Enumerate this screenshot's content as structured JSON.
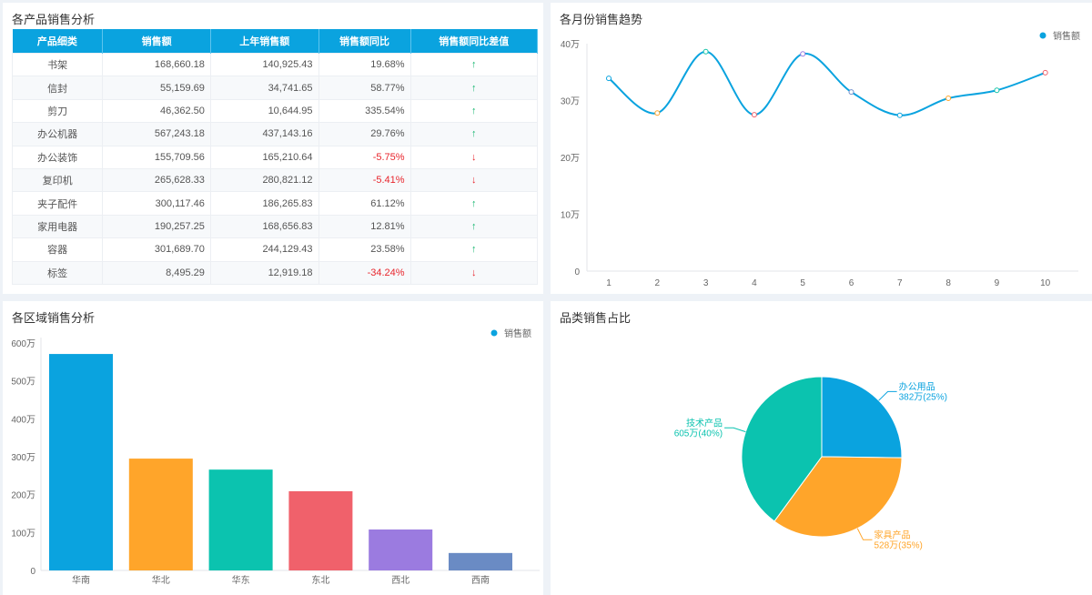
{
  "table_panel": {
    "title": "各产品销售分析",
    "headers": [
      "产品细类",
      "销售额",
      "上年销售额",
      "销售额同比",
      "销售额同比差值"
    ],
    "rows": [
      [
        "书架",
        "168,660.18",
        "140,925.43",
        "19.68%",
        "up"
      ],
      [
        "信封",
        "55,159.69",
        "34,741.65",
        "58.77%",
        "up"
      ],
      [
        "剪刀",
        "46,362.50",
        "10,644.95",
        "335.54%",
        "up"
      ],
      [
        "办公机器",
        "567,243.18",
        "437,143.16",
        "29.76%",
        "up"
      ],
      [
        "办公装饰",
        "155,709.56",
        "165,210.64",
        "-5.75%",
        "down"
      ],
      [
        "复印机",
        "265,628.33",
        "280,821.12",
        "-5.41%",
        "down"
      ],
      [
        "夹子配件",
        "300,117.46",
        "186,265.83",
        "61.12%",
        "up"
      ],
      [
        "家用电器",
        "190,257.25",
        "168,656.83",
        "12.81%",
        "up"
      ],
      [
        "容器",
        "301,689.70",
        "244,129.43",
        "23.58%",
        "up"
      ],
      [
        "标签",
        "8,495.29",
        "12,919.18",
        "-34.24%",
        "down"
      ]
    ]
  },
  "chart_data": [
    {
      "type": "line",
      "title": "各月份销售趋势",
      "legend": "销售额",
      "x": [
        "1",
        "2",
        "3",
        "4",
        "5",
        "6",
        "7",
        "8",
        "9",
        "10"
      ],
      "values": [
        33.9,
        27.8,
        38.6,
        27.5,
        38.2,
        31.5,
        27.4,
        30.4,
        31.8,
        34.9
      ],
      "unit": "万",
      "yticks": [
        "0",
        "10万",
        "20万",
        "30万",
        "40万"
      ],
      "ylim": [
        0,
        40
      ],
      "color": "#0aa3df",
      "marker_colors": [
        "#0aa3df",
        "#ffa52a",
        "#14c4a8",
        "#f0616b",
        "#9b7be0",
        "#6f8fcc",
        "#0aa3df",
        "#ffa52a",
        "#14c4a8",
        "#f0616b"
      ]
    },
    {
      "type": "bar",
      "title": "各区域销售分析",
      "legend": "销售额",
      "categories": [
        "华南",
        "华北",
        "华东",
        "东北",
        "西北",
        "西南"
      ],
      "values": [
        571,
        295,
        266,
        209,
        108,
        46
      ],
      "unit": "万",
      "yticks": [
        "0",
        "100万",
        "200万",
        "300万",
        "400万",
        "500万",
        "600万"
      ],
      "ylim": [
        0,
        600
      ],
      "colors": [
        "#0aa3df",
        "#ffa52a",
        "#0bc3af",
        "#f0616b",
        "#9b7be0",
        "#6a8bc4"
      ]
    },
    {
      "type": "pie",
      "title": "品类销售占比",
      "slices": [
        {
          "name": "办公用品",
          "value": 382,
          "label": "382万(25%)",
          "color": "#0aa3df"
        },
        {
          "name": "家具产品",
          "value": 528,
          "label": "528万(35%)",
          "color": "#ffa52a"
        },
        {
          "name": "技术产品",
          "value": 605,
          "label": "605万(40%)",
          "color": "#0bc3af"
        }
      ]
    }
  ]
}
